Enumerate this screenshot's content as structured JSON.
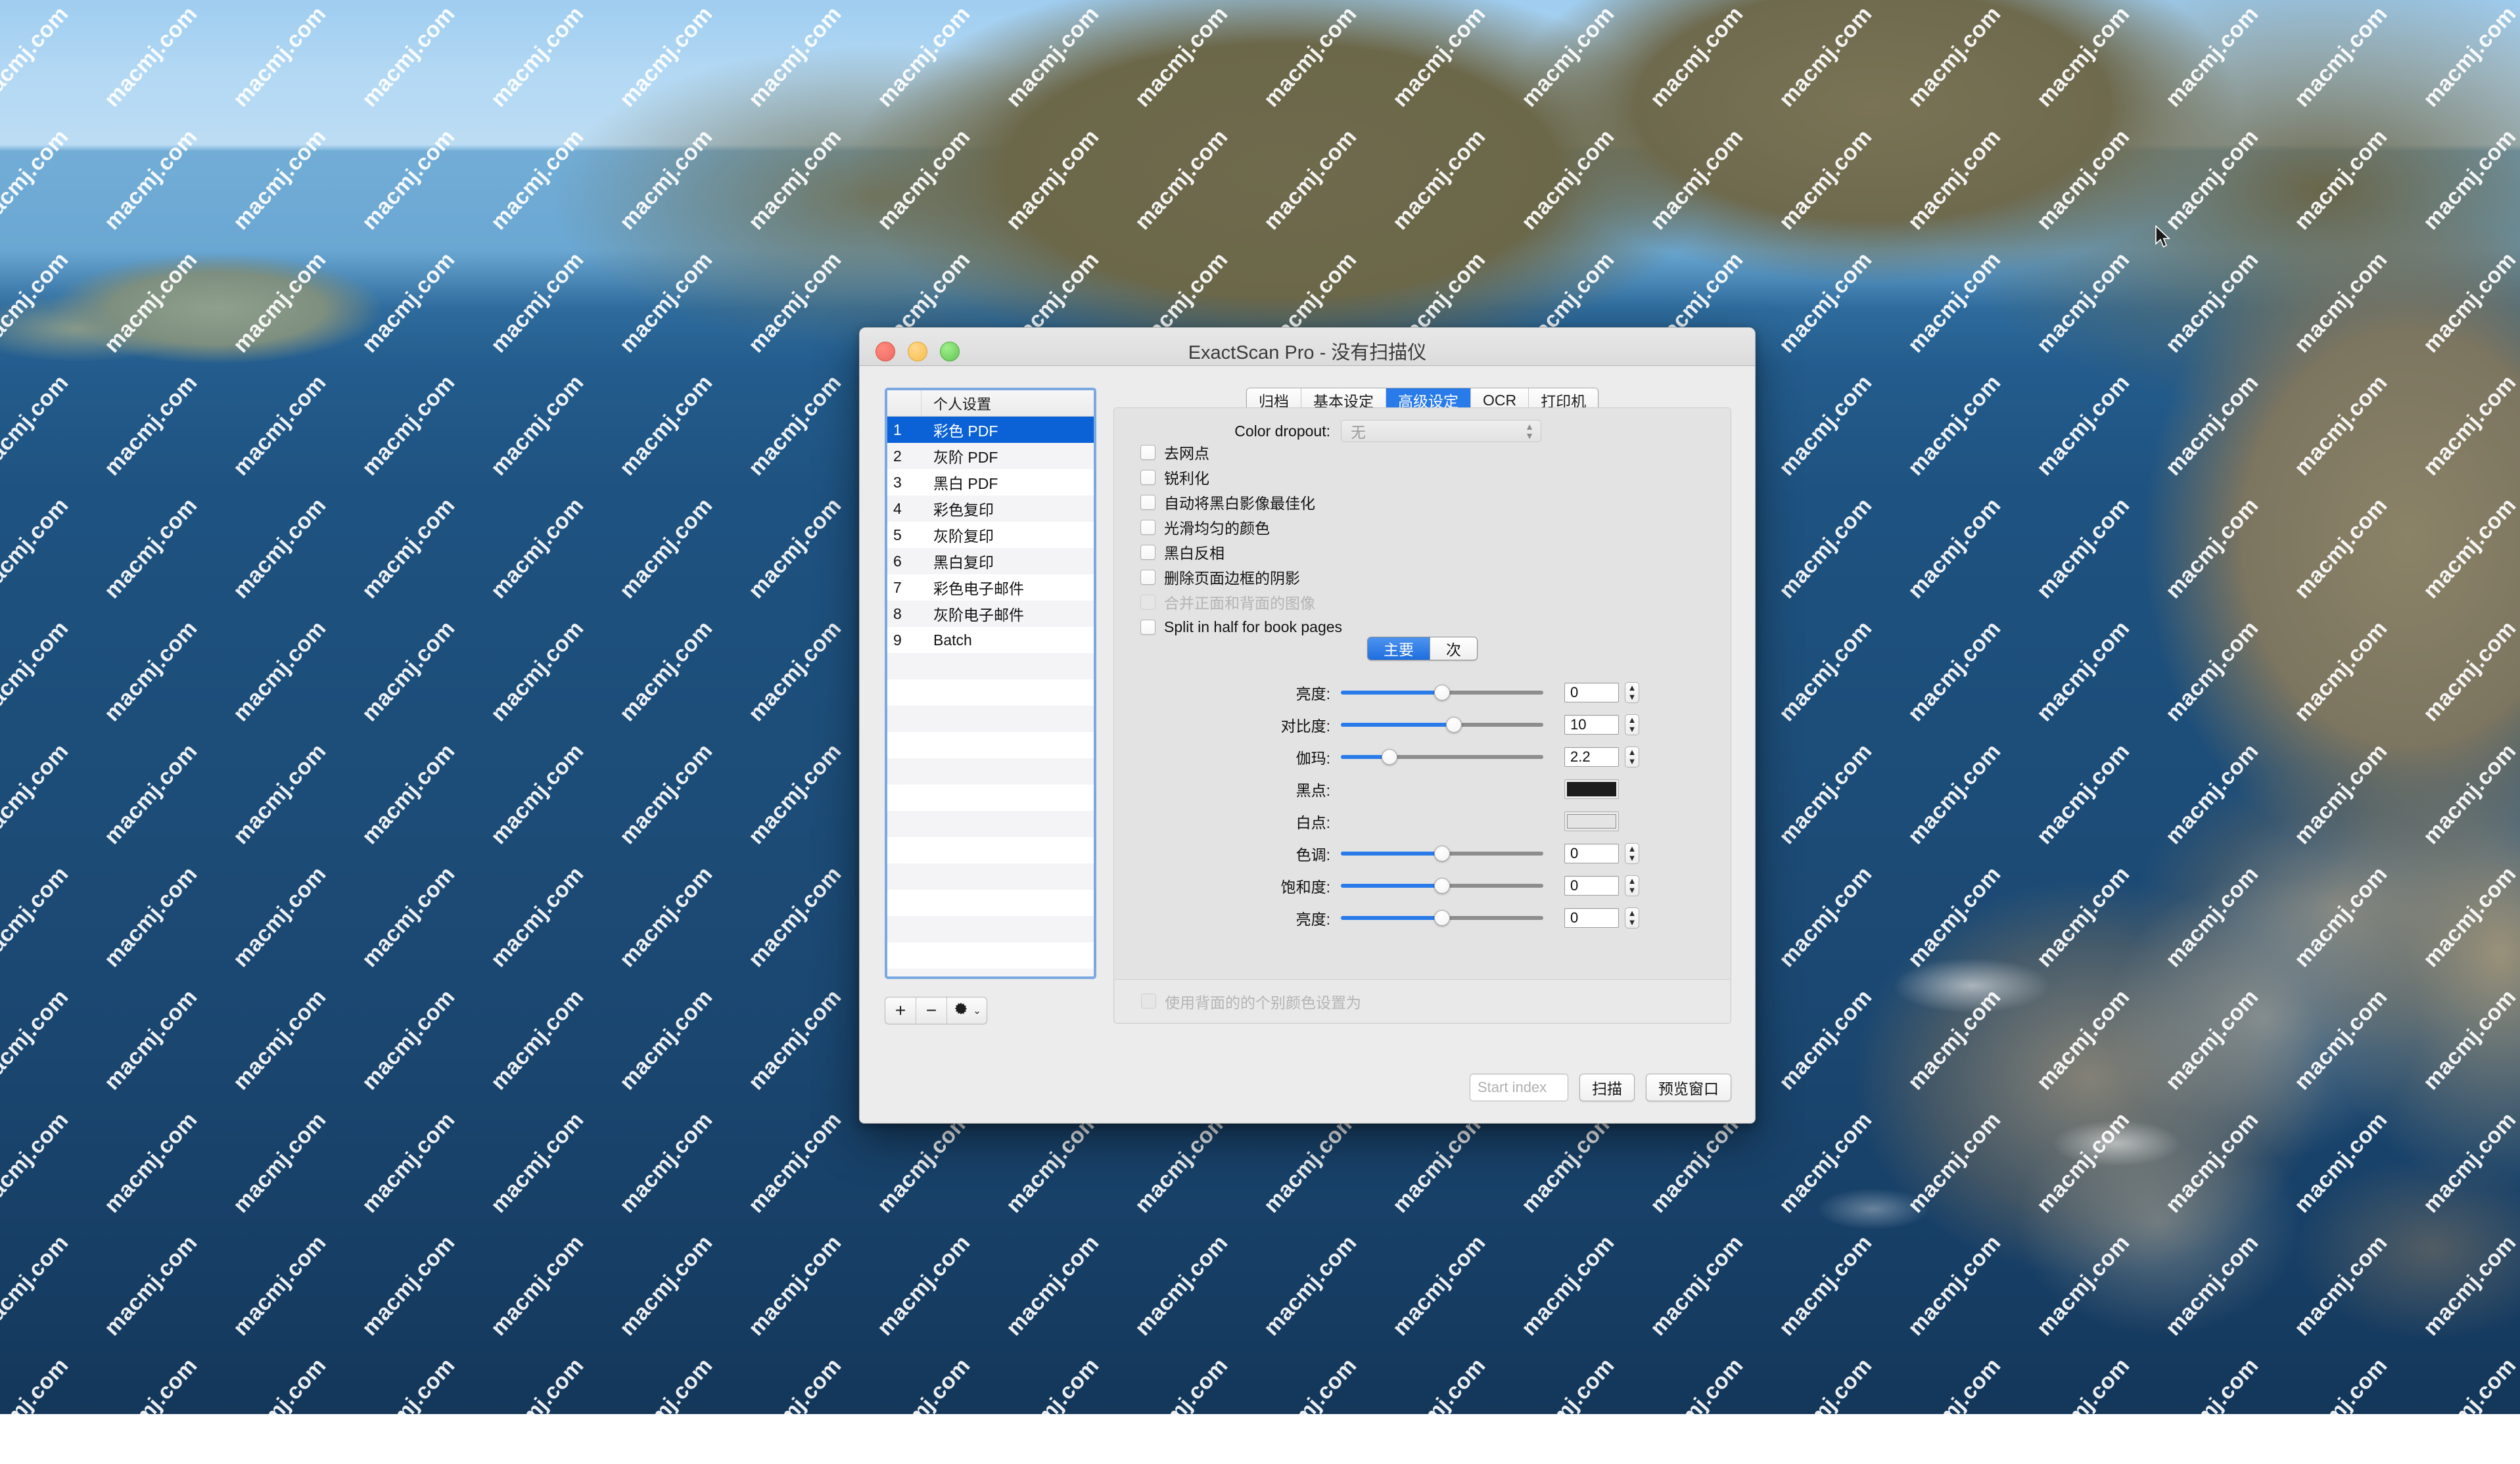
{
  "desktop": {
    "watermark_text": "macmj.com",
    "cursor": "arrow-pointer"
  },
  "window": {
    "title": "ExactScan Pro - 没有扫描仪",
    "traffic_lights": [
      "close-button",
      "minimize-button",
      "zoom-button"
    ]
  },
  "sidebar": {
    "header": {
      "num_col": "",
      "name_col": "个人设置"
    },
    "presets": [
      {
        "num": "1",
        "name": "彩色 PDF",
        "selected": true
      },
      {
        "num": "2",
        "name": "灰阶 PDF",
        "selected": false
      },
      {
        "num": "3",
        "name": "黑白 PDF",
        "selected": false
      },
      {
        "num": "4",
        "name": "彩色复印",
        "selected": false
      },
      {
        "num": "5",
        "name": "灰阶复印",
        "selected": false
      },
      {
        "num": "6",
        "name": "黑白复印",
        "selected": false
      },
      {
        "num": "7",
        "name": "彩色电子邮件",
        "selected": false
      },
      {
        "num": "8",
        "name": "灰阶电子邮件",
        "selected": false
      },
      {
        "num": "9",
        "name": "Batch",
        "selected": false
      }
    ],
    "empty_row_count": 13,
    "toolbar": {
      "add_label": "+",
      "remove_label": "−",
      "gear_label": "gear",
      "gear_chevron": "⌄"
    }
  },
  "tabs": [
    {
      "label": "归档",
      "active": false
    },
    {
      "label": "基本设定",
      "active": false
    },
    {
      "label": "高级设定",
      "active": true
    },
    {
      "label": "OCR",
      "active": false
    },
    {
      "label": "打印机",
      "active": false
    }
  ],
  "checkboxes": [
    {
      "label": "去网点",
      "checked": false,
      "disabled": false
    },
    {
      "label": "锐利化",
      "checked": false,
      "disabled": false
    },
    {
      "label": "自动将黑白影像最佳化",
      "checked": false,
      "disabled": false
    },
    {
      "label": "光滑均匀的颜色",
      "checked": false,
      "disabled": false
    },
    {
      "label": "黑白反相",
      "checked": false,
      "disabled": false
    },
    {
      "label": "删除页面边框的阴影",
      "checked": false,
      "disabled": false
    },
    {
      "label": "合并正面和背面的图像",
      "checked": false,
      "disabled": true
    },
    {
      "label": "Split in half for book pages",
      "checked": false,
      "disabled": false
    }
  ],
  "segmented": [
    {
      "label": "主要",
      "active": true
    },
    {
      "label": "次",
      "active": false
    }
  ],
  "controls": [
    {
      "type": "slider",
      "label": "亮度:",
      "value": "0",
      "percent": 50,
      "stepper": true
    },
    {
      "type": "slider",
      "label": "对比度:",
      "value": "10",
      "percent": 56,
      "stepper": true
    },
    {
      "type": "slider",
      "label": "伽玛:",
      "value": "2.2",
      "percent": 24,
      "stepper": true
    },
    {
      "type": "color",
      "label": "黑点:",
      "swatch": "black"
    },
    {
      "type": "color",
      "label": "白点:",
      "swatch": "white"
    },
    {
      "type": "slider",
      "label": "色调:",
      "value": "0",
      "percent": 50,
      "stepper": true
    },
    {
      "type": "slider",
      "label": "饱和度:",
      "value": "0",
      "percent": 50,
      "stepper": true
    },
    {
      "type": "slider",
      "label": "亮度:",
      "value": "0",
      "percent": 50,
      "stepper": true
    }
  ],
  "dropout": {
    "label": "Color dropout:",
    "value": "无"
  },
  "panel_footer": {
    "checkbox_label": "使用背面的的个别颜色设置为",
    "checked": false,
    "disabled": true
  },
  "footer": {
    "start_index_placeholder": "Start index",
    "start_index_value": "",
    "scan_label": "扫描",
    "preview_label": "预览窗口"
  },
  "colors": {
    "accent_blue": "#2a7bea",
    "selection_blue": "#0a62d6",
    "focus_ring": "#7aa8e0",
    "window_bg": "#ececec",
    "panel_bg": "#e3e3e3"
  }
}
